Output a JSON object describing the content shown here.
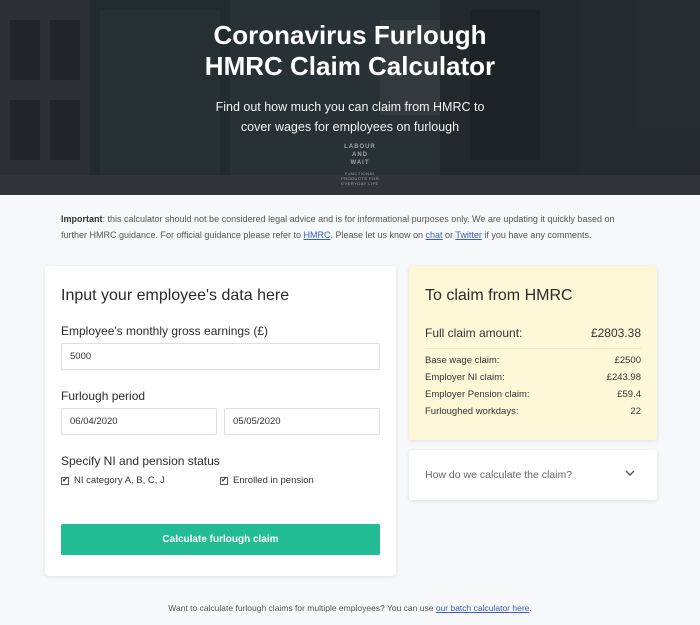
{
  "hero": {
    "title_line1": "Coronavirus Furlough",
    "title_line2": "HMRC Claim Calculator",
    "subtitle_line1": "Find out how much you can claim from HMRC to",
    "subtitle_line2": "cover wages for employees on furlough",
    "sign_line1": "LABOUR",
    "sign_line2": "AND",
    "sign_line3": "WAIT",
    "sign_small": "FUNCTIONAL PRODUCTS FOR EVERYDAY LIFE"
  },
  "notice": {
    "bold": "Important",
    "text1": ": this calculator should not be considered legal advice and is for informational purposes only. We are updating it quickly based on further HMRC guidance. For official guidance please refer to ",
    "link_hmrc": "HMRC",
    "text2": ". Please let us know on ",
    "link_chat": "chat",
    "text3": " or ",
    "link_twitter": "Twitter",
    "text4": " if you have any comments."
  },
  "form": {
    "title": "Input your employee's data here",
    "earnings_label": "Employee's monthly gross earnings (£)",
    "earnings_value": "5000",
    "period_label": "Furlough period",
    "start_date": "06/04/2020",
    "end_date": "05/05/2020",
    "status_label": "Specify NI and pension status",
    "ni_label": "NI category A, B, C, J",
    "ni_checked": true,
    "pension_label": "Enrolled in pension",
    "pension_checked": true,
    "button": "Calculate furlough claim"
  },
  "claim": {
    "title": "To claim from HMRC",
    "total_label": "Full claim amount:",
    "total_value": "£2803.38",
    "rows": [
      {
        "label": "Base wage claim:",
        "value": "£2500"
      },
      {
        "label": "Employer NI claim:",
        "value": "£243.98"
      },
      {
        "label": "Employer Pension claim:",
        "value": "£59.4"
      },
      {
        "label": "Furloughed workdays:",
        "value": "22"
      }
    ]
  },
  "accordion": {
    "label": "How do we calculate the claim?",
    "icon": "chevron-down-icon"
  },
  "footer": {
    "text": "Want to calculate furlough claims for multiple employees? You can use ",
    "link": "our batch calculator here",
    "end": "."
  },
  "colors": {
    "accent": "#22bd95",
    "claim_bg": "#fef7d8",
    "link": "#3a5fb8"
  }
}
